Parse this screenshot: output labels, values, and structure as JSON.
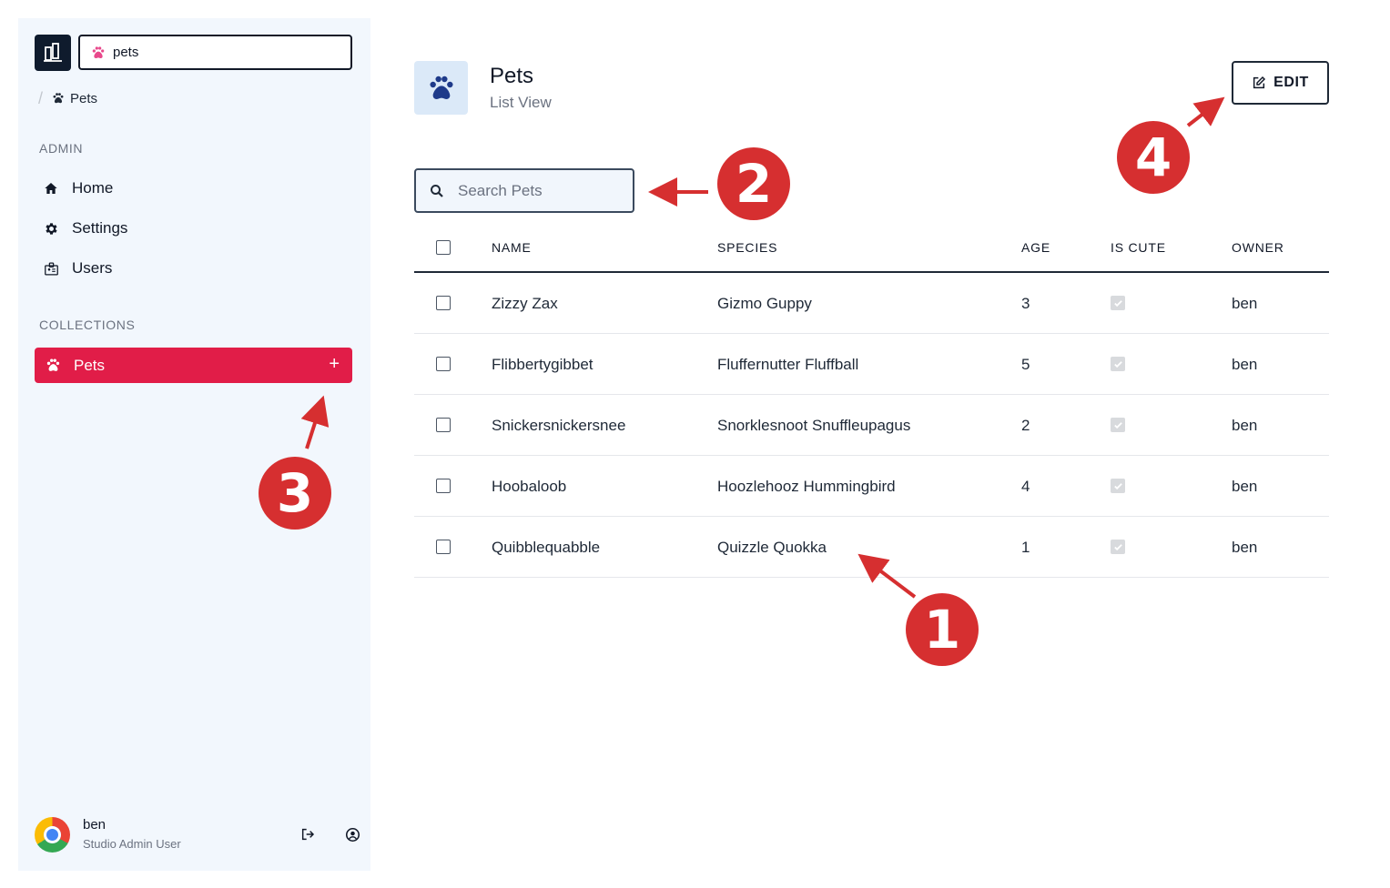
{
  "app": {
    "switcher_value": "pets",
    "breadcrumb": "Pets"
  },
  "sidebar": {
    "admin_label": "ADMIN",
    "admin_items": [
      {
        "label": "Home",
        "icon": "home-icon"
      },
      {
        "label": "Settings",
        "icon": "gear-icon"
      },
      {
        "label": "Users",
        "icon": "badge-icon"
      }
    ],
    "collections_label": "COLLECTIONS",
    "collections": [
      {
        "label": "Pets",
        "icon": "paw-icon",
        "add": "+",
        "active": true
      }
    ],
    "active_color": "#e11d48"
  },
  "user": {
    "name": "ben",
    "role": "Studio Admin User"
  },
  "header": {
    "title": "Pets",
    "subtitle": "List View",
    "edit_label": "EDIT"
  },
  "search": {
    "placeholder": "Search Pets",
    "value": ""
  },
  "table": {
    "columns": [
      "NAME",
      "SPECIES",
      "AGE",
      "IS CUTE",
      "OWNER"
    ],
    "rows": [
      {
        "name": "Zizzy Zax",
        "species": "Gizmo Guppy",
        "age": "3",
        "is_cute": true,
        "owner": "ben"
      },
      {
        "name": "Flibbertygibbet",
        "species": "Fluffernutter Fluffball",
        "age": "5",
        "is_cute": true,
        "owner": "ben"
      },
      {
        "name": "Snickersnickersnee",
        "species": "Snorklesnoot Snuffleupagus",
        "age": "2",
        "is_cute": true,
        "owner": "ben"
      },
      {
        "name": "Hoobaloob",
        "species": "Hoozlehooz Hummingbird",
        "age": "4",
        "is_cute": true,
        "owner": "ben"
      },
      {
        "name": "Quibblequabble",
        "species": "Quizzle Quokka",
        "age": "1",
        "is_cute": true,
        "owner": "ben"
      }
    ]
  },
  "annotations": [
    "1",
    "2",
    "3",
    "4"
  ],
  "annotation_color": "#d62f30"
}
